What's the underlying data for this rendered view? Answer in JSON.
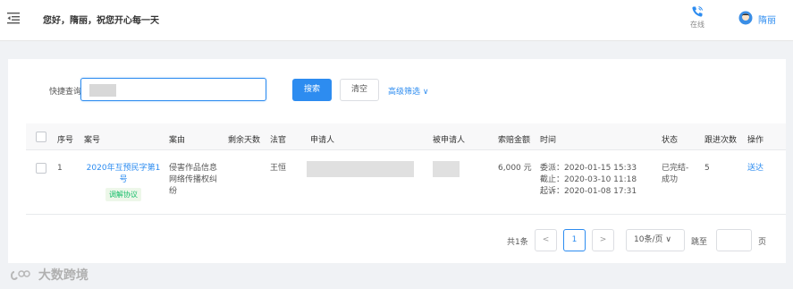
{
  "header": {
    "greeting": "您好，隋丽，祝您开心每一天",
    "status": "在线",
    "user_name": "隋丽"
  },
  "search": {
    "label": "快捷查询:",
    "search_button": "搜索",
    "clear_button": "清空",
    "advanced": "高级筛选 ∨"
  },
  "table": {
    "columns": [
      "序号",
      "案号",
      "案由",
      "剩余天数",
      "法官",
      "申请人",
      "被申请人",
      "索赔金额",
      "时间",
      "状态",
      "跟进次数",
      "操作"
    ],
    "rows": [
      {
        "index": "1",
        "case_no_line1": "2020年互预民字第1",
        "case_no_line2": "号",
        "tag": "调解协议",
        "cause_line1": "侵害作品信息",
        "cause_line2": "网络传播权纠",
        "cause_line3": "纷",
        "judge": "王恒",
        "amount": "6,000 元",
        "time_assign": "委派：2020-01-15 15:33",
        "time_deadline": "截止：2020-03-10 11:18",
        "time_filed": "起诉：2020-01-08 17:31",
        "status_line1": "已完结-",
        "status_line2": "成功",
        "follow_count": "5",
        "action": "送达"
      }
    ]
  },
  "pagination": {
    "total": "共1条",
    "prev": "<",
    "current": "1",
    "next": ">",
    "page_size": "10条/页 ∨",
    "jump_label": "跳至",
    "page_label": "页"
  },
  "watermark": "大数跨境",
  "colors": {
    "accent": "#2d8cf0",
    "tag_green": "#19be6b",
    "background": "#f0f2f5"
  }
}
